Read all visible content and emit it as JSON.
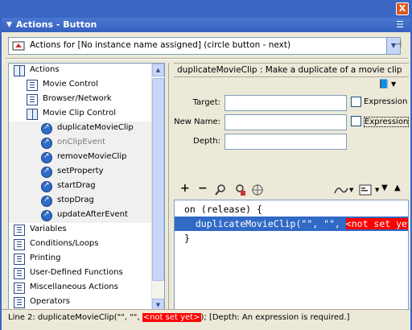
{
  "window": {
    "close_label": "X"
  },
  "panel": {
    "title": "Actions - Button"
  },
  "target": {
    "label": "Actions for [No instance name assigned] (circle button - next)"
  },
  "tree": {
    "items": [
      {
        "label": "Actions",
        "icon": "book-open-icon",
        "indent": 0
      },
      {
        "label": "Movie Control",
        "icon": "book-icon",
        "indent": 1
      },
      {
        "label": "Browser/Network",
        "icon": "book-icon",
        "indent": 1
      },
      {
        "label": "Movie Clip Control",
        "icon": "book-open-icon",
        "indent": 1
      },
      {
        "label": "duplicateMovieClip",
        "icon": "action-icon",
        "indent": 2
      },
      {
        "label": "onClipEvent",
        "icon": "action-icon",
        "indent": 2
      },
      {
        "label": "removeMovieClip",
        "icon": "action-icon",
        "indent": 2
      },
      {
        "label": "setProperty",
        "icon": "action-icon",
        "indent": 2
      },
      {
        "label": "startDrag",
        "icon": "action-icon",
        "indent": 2
      },
      {
        "label": "stopDrag",
        "icon": "action-icon",
        "indent": 2
      },
      {
        "label": "updateAfterEvent",
        "icon": "action-icon",
        "indent": 2
      },
      {
        "label": "Variables",
        "icon": "book-icon",
        "indent": 0
      },
      {
        "label": "Conditions/Loops",
        "icon": "book-icon",
        "indent": 0
      },
      {
        "label": "Printing",
        "icon": "book-icon",
        "indent": 0
      },
      {
        "label": "User-Defined Functions",
        "icon": "book-icon",
        "indent": 0
      },
      {
        "label": "Miscellaneous Actions",
        "icon": "book-icon",
        "indent": 0
      },
      {
        "label": "Operators",
        "icon": "book-icon",
        "indent": 0
      }
    ]
  },
  "description": "duplicateMovieClip : Make a duplicate of a movie clip",
  "params": {
    "target_label": "Target:",
    "newname_label": "New Name:",
    "depth_label": "Depth:",
    "expression_label": "Expression",
    "target_value": "",
    "newname_value": "",
    "depth_value": ""
  },
  "toolbar": {
    "add": "+",
    "remove": "−"
  },
  "code": {
    "line1": "on (release) {",
    "line2_prefix": "  duplicateMovieClip(\"\", \"\", ",
    "line2_warn": "<not set yet>",
    "line3": "}"
  },
  "status": {
    "prefix": "Line 2: duplicateMovieClip(\"\", \"\", ",
    "warn": "<not set yet>",
    "suffix": "); [Depth: An expression is required.]"
  },
  "colors": {
    "selection": "#316ac5",
    "warning": "#ff0000",
    "titlebar": "#3a66c4"
  }
}
